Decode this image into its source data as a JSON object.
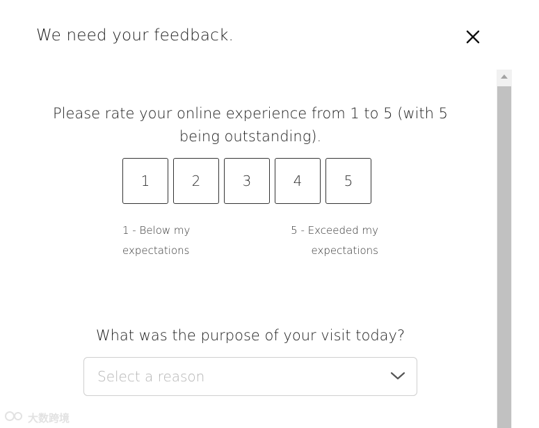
{
  "dialog": {
    "title": "We need your feedback."
  },
  "rating": {
    "question": "Please rate your online experience from 1 to 5 (with 5 being outstanding).",
    "options": [
      "1",
      "2",
      "3",
      "4",
      "5"
    ],
    "low_label": "1 - Below my expectations",
    "high_label": "5 - Exceeded my expectations"
  },
  "purpose": {
    "question": "What was the purpose of your visit today?",
    "placeholder": "Select a reason"
  },
  "watermark": {
    "text": "大数跨境"
  },
  "icons": {
    "close": "close-icon",
    "chevron": "chevron-down-icon",
    "scroll_up": "scroll-up-arrow-icon"
  }
}
